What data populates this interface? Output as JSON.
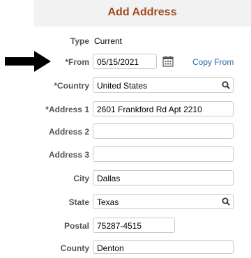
{
  "header": {
    "title": "Add Address"
  },
  "form": {
    "type": {
      "label": "Type",
      "value": "Current"
    },
    "from": {
      "label": "*From",
      "value": "05/15/2021",
      "copy_link": "Copy From"
    },
    "country": {
      "label": "*Country",
      "value": "United States"
    },
    "address1": {
      "label": "*Address 1",
      "value": "2601 Frankford Rd Apt 2210"
    },
    "address2": {
      "label": "Address 2",
      "value": ""
    },
    "address3": {
      "label": "Address 3",
      "value": ""
    },
    "city": {
      "label": "City",
      "value": "Dallas"
    },
    "state": {
      "label": "State",
      "value": "Texas"
    },
    "postal": {
      "label": "Postal",
      "value": "75287-4515"
    },
    "county": {
      "label": "County",
      "value": "Denton"
    }
  },
  "icons": {
    "calendar": "calendar-icon",
    "search": "search-icon",
    "arrow": "right-arrow-icon"
  },
  "colors": {
    "title": "#a04a1f",
    "link": "#2e6da4",
    "label": "#555555"
  }
}
